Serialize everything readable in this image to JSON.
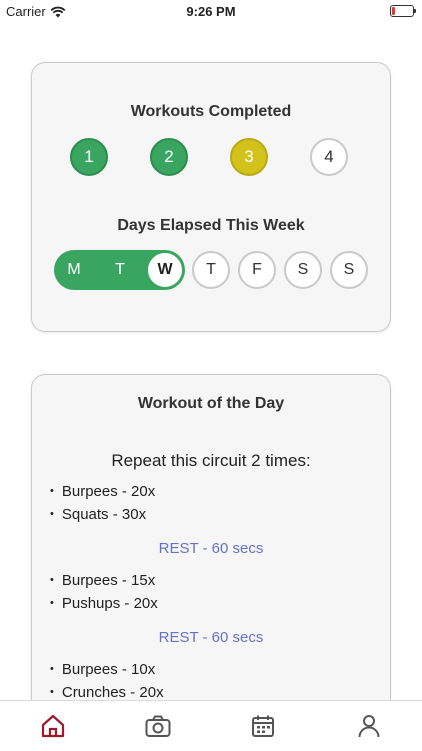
{
  "status_bar": {
    "carrier": "Carrier",
    "time": "9:26 PM"
  },
  "workouts_card": {
    "title": "Workouts Completed",
    "workouts": [
      {
        "label": "1",
        "state": "completed"
      },
      {
        "label": "2",
        "state": "completed"
      },
      {
        "label": "3",
        "state": "current"
      },
      {
        "label": "4",
        "state": "upcoming"
      }
    ]
  },
  "days_card": {
    "title": "Days Elapsed This Week",
    "days": [
      {
        "label": "M",
        "state": "elapsed"
      },
      {
        "label": "T",
        "state": "elapsed"
      },
      {
        "label": "W",
        "state": "today"
      },
      {
        "label": "T",
        "state": "future"
      },
      {
        "label": "F",
        "state": "future"
      },
      {
        "label": "S",
        "state": "future"
      },
      {
        "label": "S",
        "state": "future"
      }
    ]
  },
  "wod_card": {
    "title": "Workout of the Day",
    "intro": "Repeat this circuit 2 times:",
    "exercises": [
      "Burpees - 20x",
      "Squats - 30x",
      "Burpees - 15x",
      "Pushups - 20x",
      "Burpees - 10x",
      "Crunches - 20x"
    ],
    "rest": [
      "REST - 60 secs",
      "REST - 60 secs"
    ]
  },
  "tabs": [
    "home-icon",
    "camera-icon",
    "calendar-icon",
    "profile-icon"
  ],
  "colors": {
    "green": "#3aa561",
    "yellow": "#d2c21a",
    "rest_blue": "#6473c9",
    "active_tab": "#9b1b2b",
    "inactive_tab": "#555555"
  }
}
